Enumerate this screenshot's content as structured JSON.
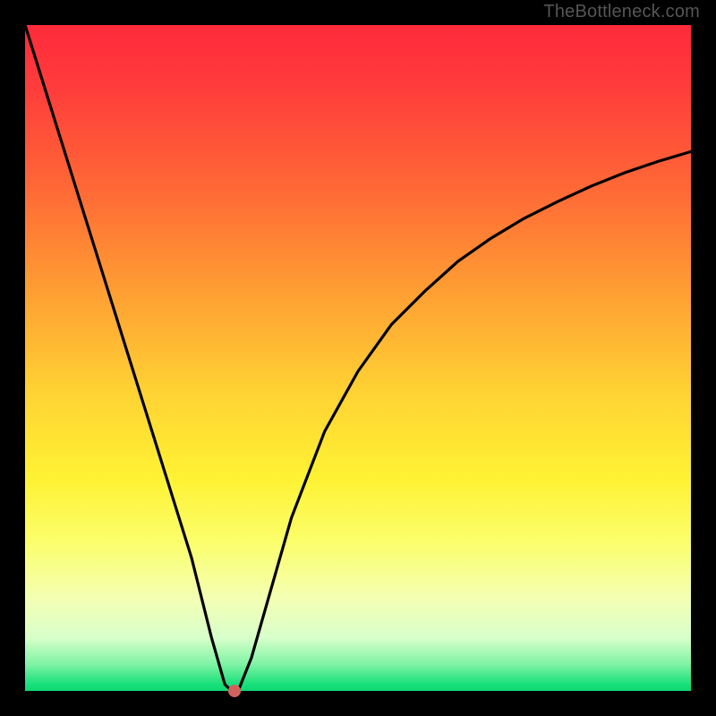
{
  "watermark": "TheBottleneck.com",
  "colors": {
    "background": "#000000",
    "gradient_top": "#ff2a3b",
    "gradient_bottom": "#0fd76f",
    "curve": "#000000",
    "min_point": "#d1625b",
    "watermark_text": "#555555"
  },
  "chart_data": {
    "type": "line",
    "title": "",
    "xlabel": "",
    "ylabel": "",
    "xlim": [
      0,
      100
    ],
    "ylim": [
      0,
      100
    ],
    "grid": false,
    "series": [
      {
        "name": "bottleneck-curve",
        "x": [
          0,
          5,
          10,
          15,
          20,
          25,
          28,
          30,
          31,
          32,
          34,
          36,
          40,
          45,
          50,
          55,
          60,
          65,
          70,
          75,
          80,
          85,
          90,
          95,
          100
        ],
        "values": [
          100,
          84,
          68,
          52,
          36,
          20,
          8,
          1,
          0,
          0,
          5,
          12,
          26,
          39,
          48,
          55,
          60,
          64.5,
          68,
          71,
          73.5,
          75.8,
          77.8,
          79.5,
          81
        ]
      }
    ],
    "annotations": [
      {
        "name": "optimum",
        "x": 31.5,
        "y": 0
      }
    ]
  }
}
